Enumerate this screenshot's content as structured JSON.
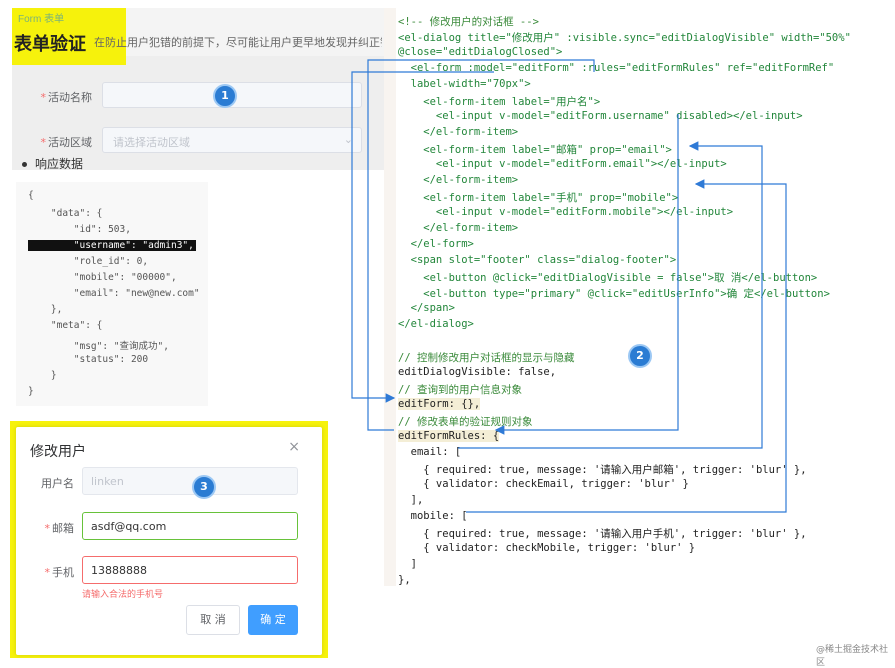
{
  "form_demo": {
    "tag_small": "Form 表单",
    "tag_title": "表单验证",
    "description": "在防止用户犯错的前提下，尽可能让用户更早地发现并纠正错误。",
    "fields": [
      {
        "label": "活动名称",
        "placeholder": ""
      },
      {
        "label": "活动区域",
        "placeholder": "请选择活动区域"
      }
    ],
    "badge": "1"
  },
  "response": {
    "bullet": "响应数据",
    "lines": [
      "{",
      "    \"data\": {",
      "        \"id\": 503,",
      "        \"username\": \"admin3\",",
      "        \"role_id\": 0,",
      "        \"mobile\": \"00000\",",
      "        \"email\": \"new@new.com\"",
      "    },",
      "    \"meta\": {",
      "        \"msg\": \"查询成功\",",
      "        \"status\": 200",
      "    }",
      "}"
    ]
  },
  "dialog": {
    "title": "修改用户",
    "close": "×",
    "username_label": "用户名",
    "username_value": "linken",
    "email_label": "邮箱",
    "email_value": "asdf@qq.com",
    "mobile_label": "手机",
    "mobile_value": "13888888",
    "error": "请输入合法的手机号",
    "cancel": "取 消",
    "confirm": "确 定",
    "badge": "3"
  },
  "code": {
    "lines": [
      "<!-- 修改用户的对话框 -->",
      "<el-dialog title=\"修改用户\" :visible.sync=\"editDialogVisible\" width=\"50%\"",
      "@close=\"editDialogClosed\">",
      "  <el-form :model=\"editForm\" :rules=\"editFormRules\" ref=\"editFormRef\"",
      "  label-width=\"70px\">",
      "    <el-form-item label=\"用户名\">",
      "      <el-input v-model=\"editForm.username\" disabled></el-input>",
      "    </el-form-item>",
      "    <el-form-item label=\"邮箱\" prop=\"email\">",
      "      <el-input v-model=\"editForm.email\"></el-input>",
      "    </el-form-item>",
      "    <el-form-item label=\"手机\" prop=\"mobile\">",
      "      <el-input v-model=\"editForm.mobile\"></el-input>",
      "    </el-form-item>",
      "  </el-form>",
      "  <span slot=\"footer\" class=\"dialog-footer\">",
      "    <el-button @click=\"editDialogVisible = false\">取 消</el-button>",
      "    <el-button type=\"primary\" @click=\"editUserInfo\">确 定</el-button>",
      "  </span>",
      "</el-dialog>",
      "",
      "// 控制修改用户对话框的显示与隐藏",
      "editDialogVisible: false,",
      "// 查询到的用户信息对象",
      "editForm: {},",
      "// 修改表单的验证规则对象",
      "editFormRules: {",
      "  email: [",
      "    { required: true, message: '请输入用户邮箱', trigger: 'blur' },",
      "    { validator: checkEmail, trigger: 'blur' }",
      "  ],",
      "  mobile: [",
      "    { required: true, message: '请输入用户手机', trigger: 'blur' },",
      "    { validator: checkMobile, trigger: 'blur' }",
      "  ]",
      "},"
    ],
    "badge": "2"
  },
  "watermark": "@稀土掘金技术社区",
  "colors": {
    "highlight_yellow": "#f6f20c",
    "primary_blue": "#409eff",
    "arrow_blue": "#2f7ad6",
    "box_pink": "#e0407a"
  }
}
